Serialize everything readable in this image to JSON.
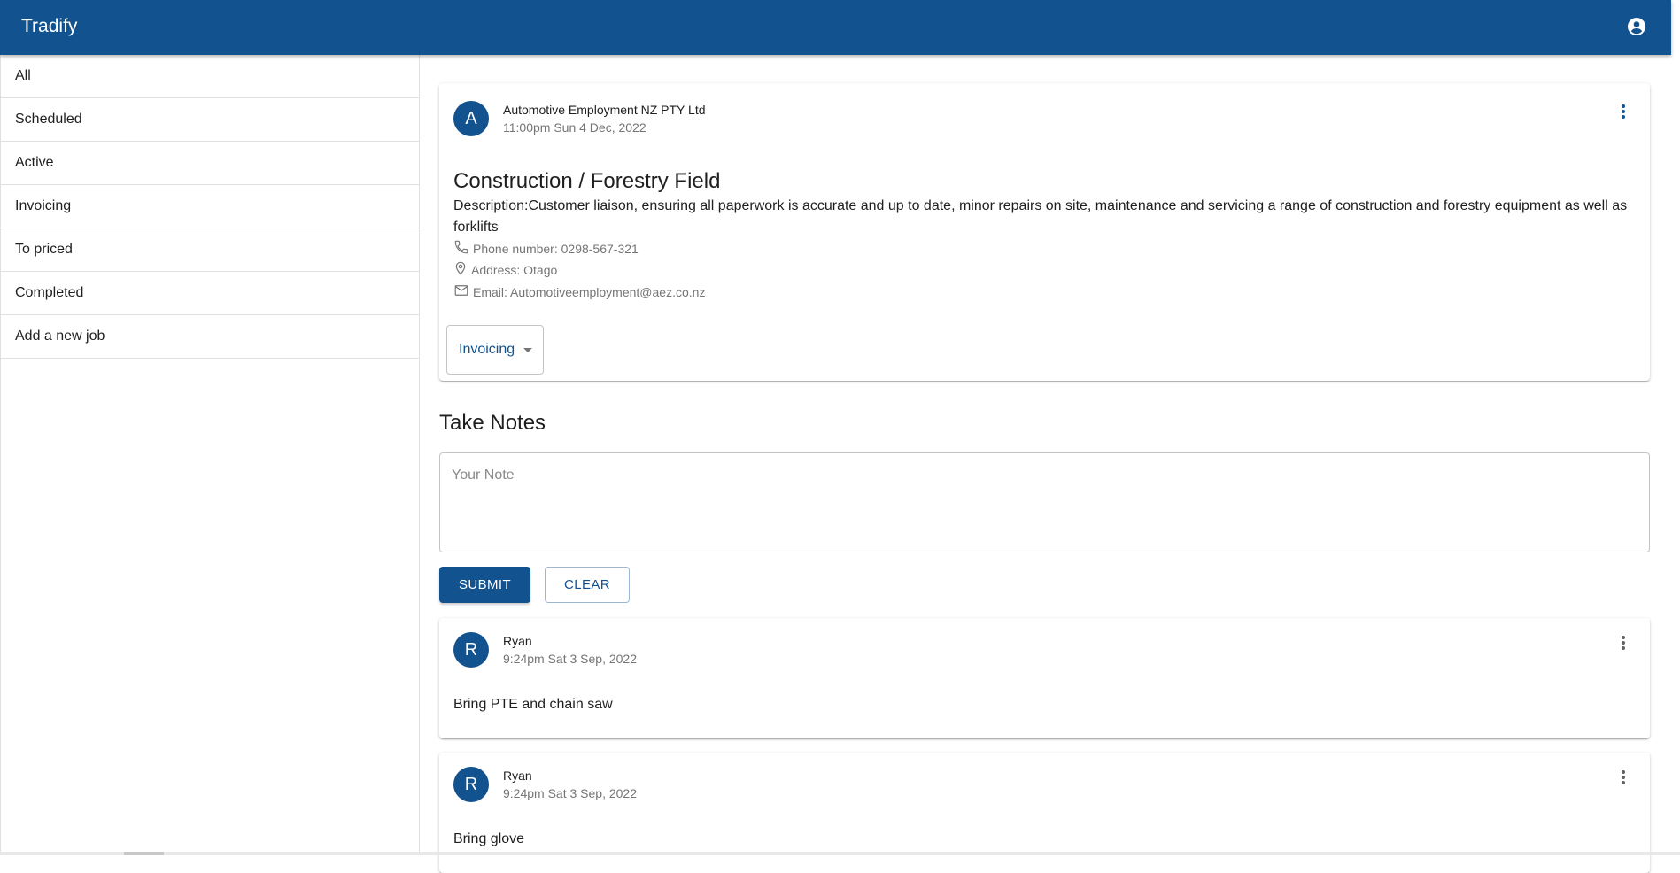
{
  "app": {
    "title": "Tradify"
  },
  "sidebar": {
    "items": [
      {
        "label": "All"
      },
      {
        "label": "Scheduled"
      },
      {
        "label": "Active"
      },
      {
        "label": "Invoicing"
      },
      {
        "label": "To priced"
      },
      {
        "label": "Completed"
      },
      {
        "label": "Add a new job"
      }
    ]
  },
  "job": {
    "avatar_letter": "A",
    "company": "Automotive Employment NZ PTY Ltd",
    "time": "11:00pm Sun 4 Dec, 2022",
    "title": "Construction / Forestry Field",
    "description": "Description:Customer liaison, ensuring all paperwork is accurate and up to date, minor repairs on site, maintenance and servicing a range of construction and forestry equipment as well as forklifts",
    "phone": "Phone number: 0298-567-321",
    "address": "Address: Otago",
    "email": "Email: Automotiveemployment@aez.co.nz",
    "status": "Invoicing"
  },
  "notes_section": {
    "title": "Take Notes",
    "placeholder": "Your Note",
    "value": "",
    "submit_label": "SUBMIT",
    "clear_label": "CLEAR"
  },
  "notes": [
    {
      "avatar_letter": "R",
      "author": "Ryan",
      "time": "9:24pm Sat 3 Sep, 2022",
      "text": "Bring PTE and chain saw"
    },
    {
      "avatar_letter": "R",
      "author": "Ryan",
      "time": "9:24pm Sat 3 Sep, 2022",
      "text": "Bring glove"
    }
  ],
  "colors": {
    "primary": "#11528f",
    "muted": "#757575",
    "border": "#e0e0e0"
  }
}
